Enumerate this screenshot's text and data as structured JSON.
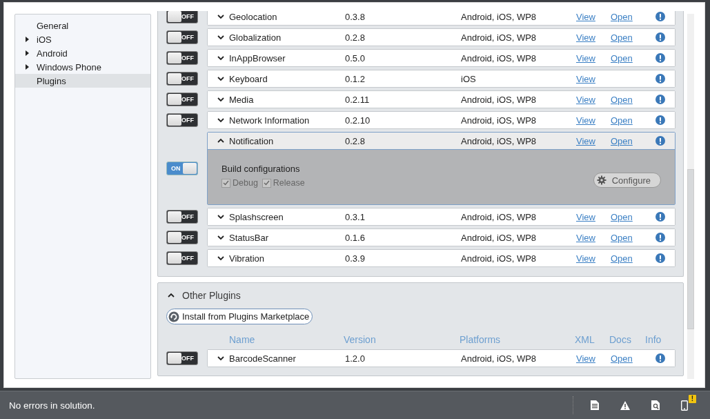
{
  "sidebar": {
    "items": [
      {
        "label": "General",
        "expandable": false,
        "selected": false
      },
      {
        "label": "iOS",
        "expandable": true,
        "selected": false
      },
      {
        "label": "Android",
        "expandable": true,
        "selected": false
      },
      {
        "label": "Windows Phone",
        "expandable": true,
        "selected": false
      },
      {
        "label": "Plugins",
        "expandable": false,
        "selected": true
      }
    ]
  },
  "plugin_groups": [
    {
      "rows": [
        {
          "name": "Geolocation",
          "version": "0.3.8",
          "platforms": "Android, iOS, WP8",
          "xml": "View",
          "docs": "Open",
          "enabled": false,
          "toggle_label": "OFF",
          "expanded": false
        },
        {
          "name": "Globalization",
          "version": "0.2.8",
          "platforms": "Android, iOS, WP8",
          "xml": "View",
          "docs": "Open",
          "enabled": false,
          "toggle_label": "OFF",
          "expanded": false
        },
        {
          "name": "InAppBrowser",
          "version": "0.5.0",
          "platforms": "Android, iOS, WP8",
          "xml": "View",
          "docs": "Open",
          "enabled": false,
          "toggle_label": "OFF",
          "expanded": false
        },
        {
          "name": "Keyboard",
          "version": "0.1.2",
          "platforms": "iOS",
          "xml": "View",
          "enabled": false,
          "toggle_label": "OFF",
          "expanded": false
        },
        {
          "name": "Media",
          "version": "0.2.11",
          "platforms": "Android, iOS, WP8",
          "xml": "View",
          "docs": "Open",
          "enabled": false,
          "toggle_label": "OFF",
          "expanded": false
        },
        {
          "name": "Network Information",
          "version": "0.2.10",
          "platforms": "Android, iOS, WP8",
          "xml": "View",
          "docs": "Open",
          "enabled": false,
          "toggle_label": "OFF",
          "expanded": false
        },
        {
          "name": "Notification",
          "version": "0.2.8",
          "platforms": "Android, iOS, WP8",
          "xml": "View",
          "docs": "Open",
          "enabled": true,
          "toggle_label": "ON",
          "expanded": true,
          "details": {
            "heading": "Build configurations",
            "options": [
              {
                "label": "Debug",
                "checked": true,
                "disabled": true
              },
              {
                "label": "Release",
                "checked": true,
                "disabled": true
              }
            ],
            "configure_button": "Configure"
          }
        },
        {
          "name": "Splashscreen",
          "version": "0.3.1",
          "platforms": "Android, iOS, WP8",
          "xml": "View",
          "docs": "Open",
          "enabled": false,
          "toggle_label": "OFF",
          "expanded": false
        },
        {
          "name": "StatusBar",
          "version": "0.1.6",
          "platforms": "Android, iOS, WP8",
          "xml": "View",
          "docs": "Open",
          "enabled": false,
          "toggle_label": "OFF",
          "expanded": false
        },
        {
          "name": "Vibration",
          "version": "0.3.9",
          "platforms": "Android, iOS, WP8",
          "xml": "View",
          "docs": "Open",
          "enabled": false,
          "toggle_label": "OFF",
          "expanded": false
        }
      ]
    },
    {
      "title": "Other Plugins",
      "expanded": true,
      "install_button": "Install from Plugins Marketplace",
      "columns": [
        "Name",
        "Version",
        "Platforms",
        "XML",
        "Docs",
        "Info"
      ],
      "rows": [
        {
          "name": "BarcodeScanner",
          "version": "1.2.0",
          "platforms": "Android, iOS, WP8",
          "xml": "View",
          "docs": "Open",
          "enabled": false,
          "toggle_label": "OFF",
          "expanded": false
        }
      ]
    }
  ],
  "status_bar": {
    "message": "No errors in solution.",
    "badge": "!"
  }
}
